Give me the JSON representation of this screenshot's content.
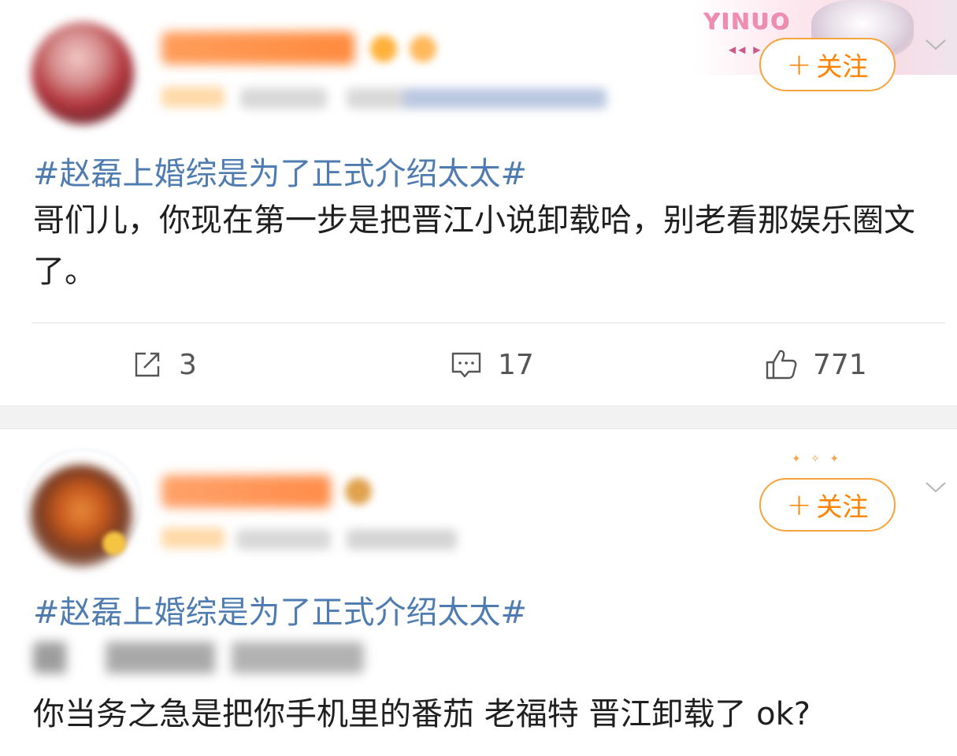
{
  "posts": [
    {
      "topic": "#赵磊上婚综是为了正式介绍太太#",
      "body": "哥们儿，你现在第一步是把晋江小说卸载哈，别老看那娱乐圈文了。",
      "follow_label": "关注",
      "follow_plus": "+",
      "decoration_text": "YINUO",
      "decoration_arrows": "◀◀ ▶",
      "actions": {
        "share": "3",
        "comment": "17",
        "like": "771"
      },
      "icons": [
        "share-icon",
        "comment-icon",
        "like-icon",
        "chevron-down-icon"
      ]
    },
    {
      "topic": "#赵磊上婚综是为了正式介绍太太#",
      "body": "你当务之急是把你手机里的番茄 老福特 晋江卸载了 ok?",
      "follow_label": "关注",
      "follow_plus": "+",
      "decoration_sparkles": "✦ ✧ ✦",
      "icons": [
        "chevron-down-icon"
      ]
    }
  ],
  "colors": {
    "topic": "#4f7cb0",
    "follow": "#ff8200",
    "follow_border": "#f4a43c",
    "separator": "#f2f2f2"
  }
}
